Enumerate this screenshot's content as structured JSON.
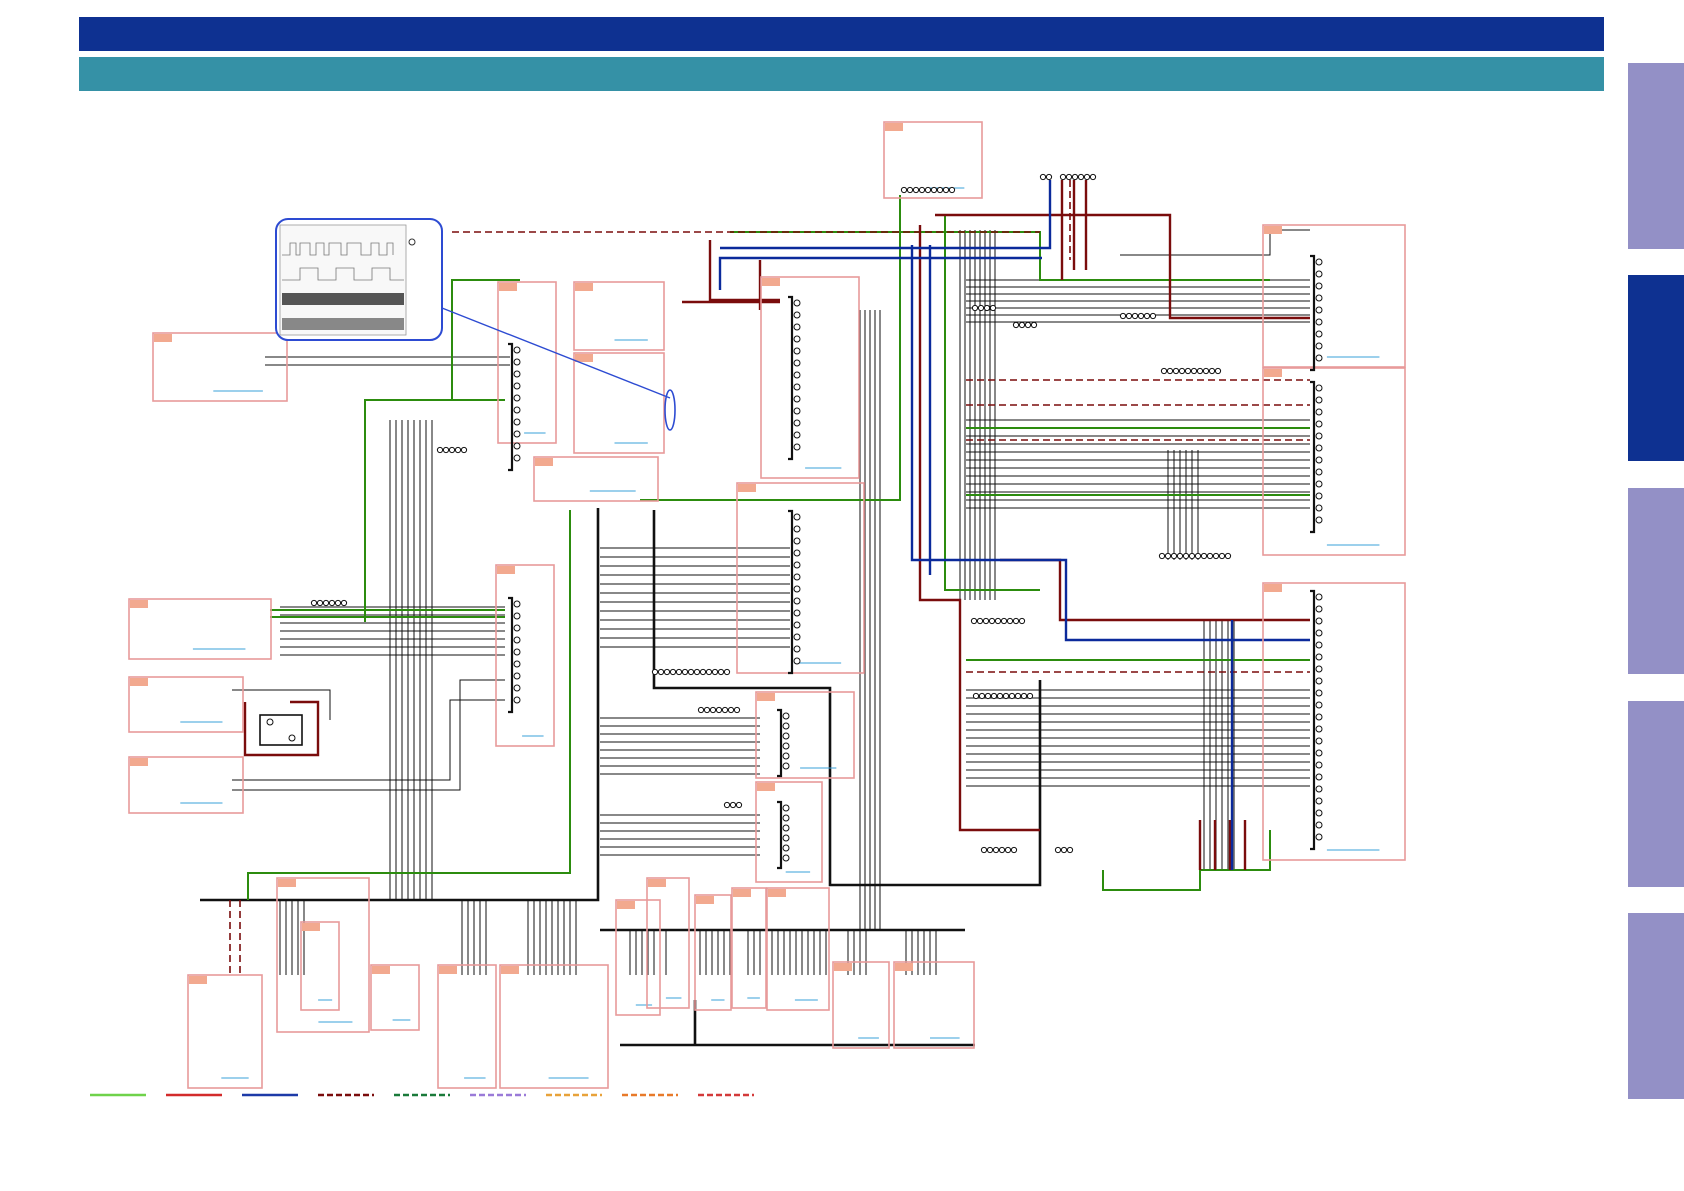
{
  "colors": {
    "title_bar": "#0e3191",
    "subtitle_bar": "#3591a6",
    "tab_inactive": "#9390c6",
    "tab_active": "#0e3191",
    "block_border": "#e89a9a",
    "block_header": "#f2a98f",
    "wire": "#111111",
    "wire_green": "#2c8c0e",
    "wire_red": "#7a0c0c",
    "wire_blue": "#0b2a9b",
    "callout_border": "#2d4bd2",
    "link_blue": "#3aa0d8"
  },
  "side_tabs": [
    {
      "name": "side-tab-1",
      "active": false
    },
    {
      "name": "side-tab-2",
      "active": true
    },
    {
      "name": "side-tab-3",
      "active": false
    },
    {
      "name": "side-tab-4",
      "active": false
    },
    {
      "name": "side-tab-5",
      "active": false
    }
  ],
  "legend": [
    {
      "color": "#6fd24a",
      "style": "solid"
    },
    {
      "color": "#d32b2b",
      "style": "solid"
    },
    {
      "color": "#1d3aa8",
      "style": "solid"
    },
    {
      "color": "#7a0c0c",
      "style": "dashed"
    },
    {
      "color": "#1a7a3a",
      "style": "dashed"
    },
    {
      "color": "#9a7ad8",
      "style": "dashed"
    },
    {
      "color": "#e8a23a",
      "style": "dashed"
    },
    {
      "color": "#e87a2a",
      "style": "dashed"
    },
    {
      "color": "#d33a3a",
      "style": "dashed"
    }
  ]
}
